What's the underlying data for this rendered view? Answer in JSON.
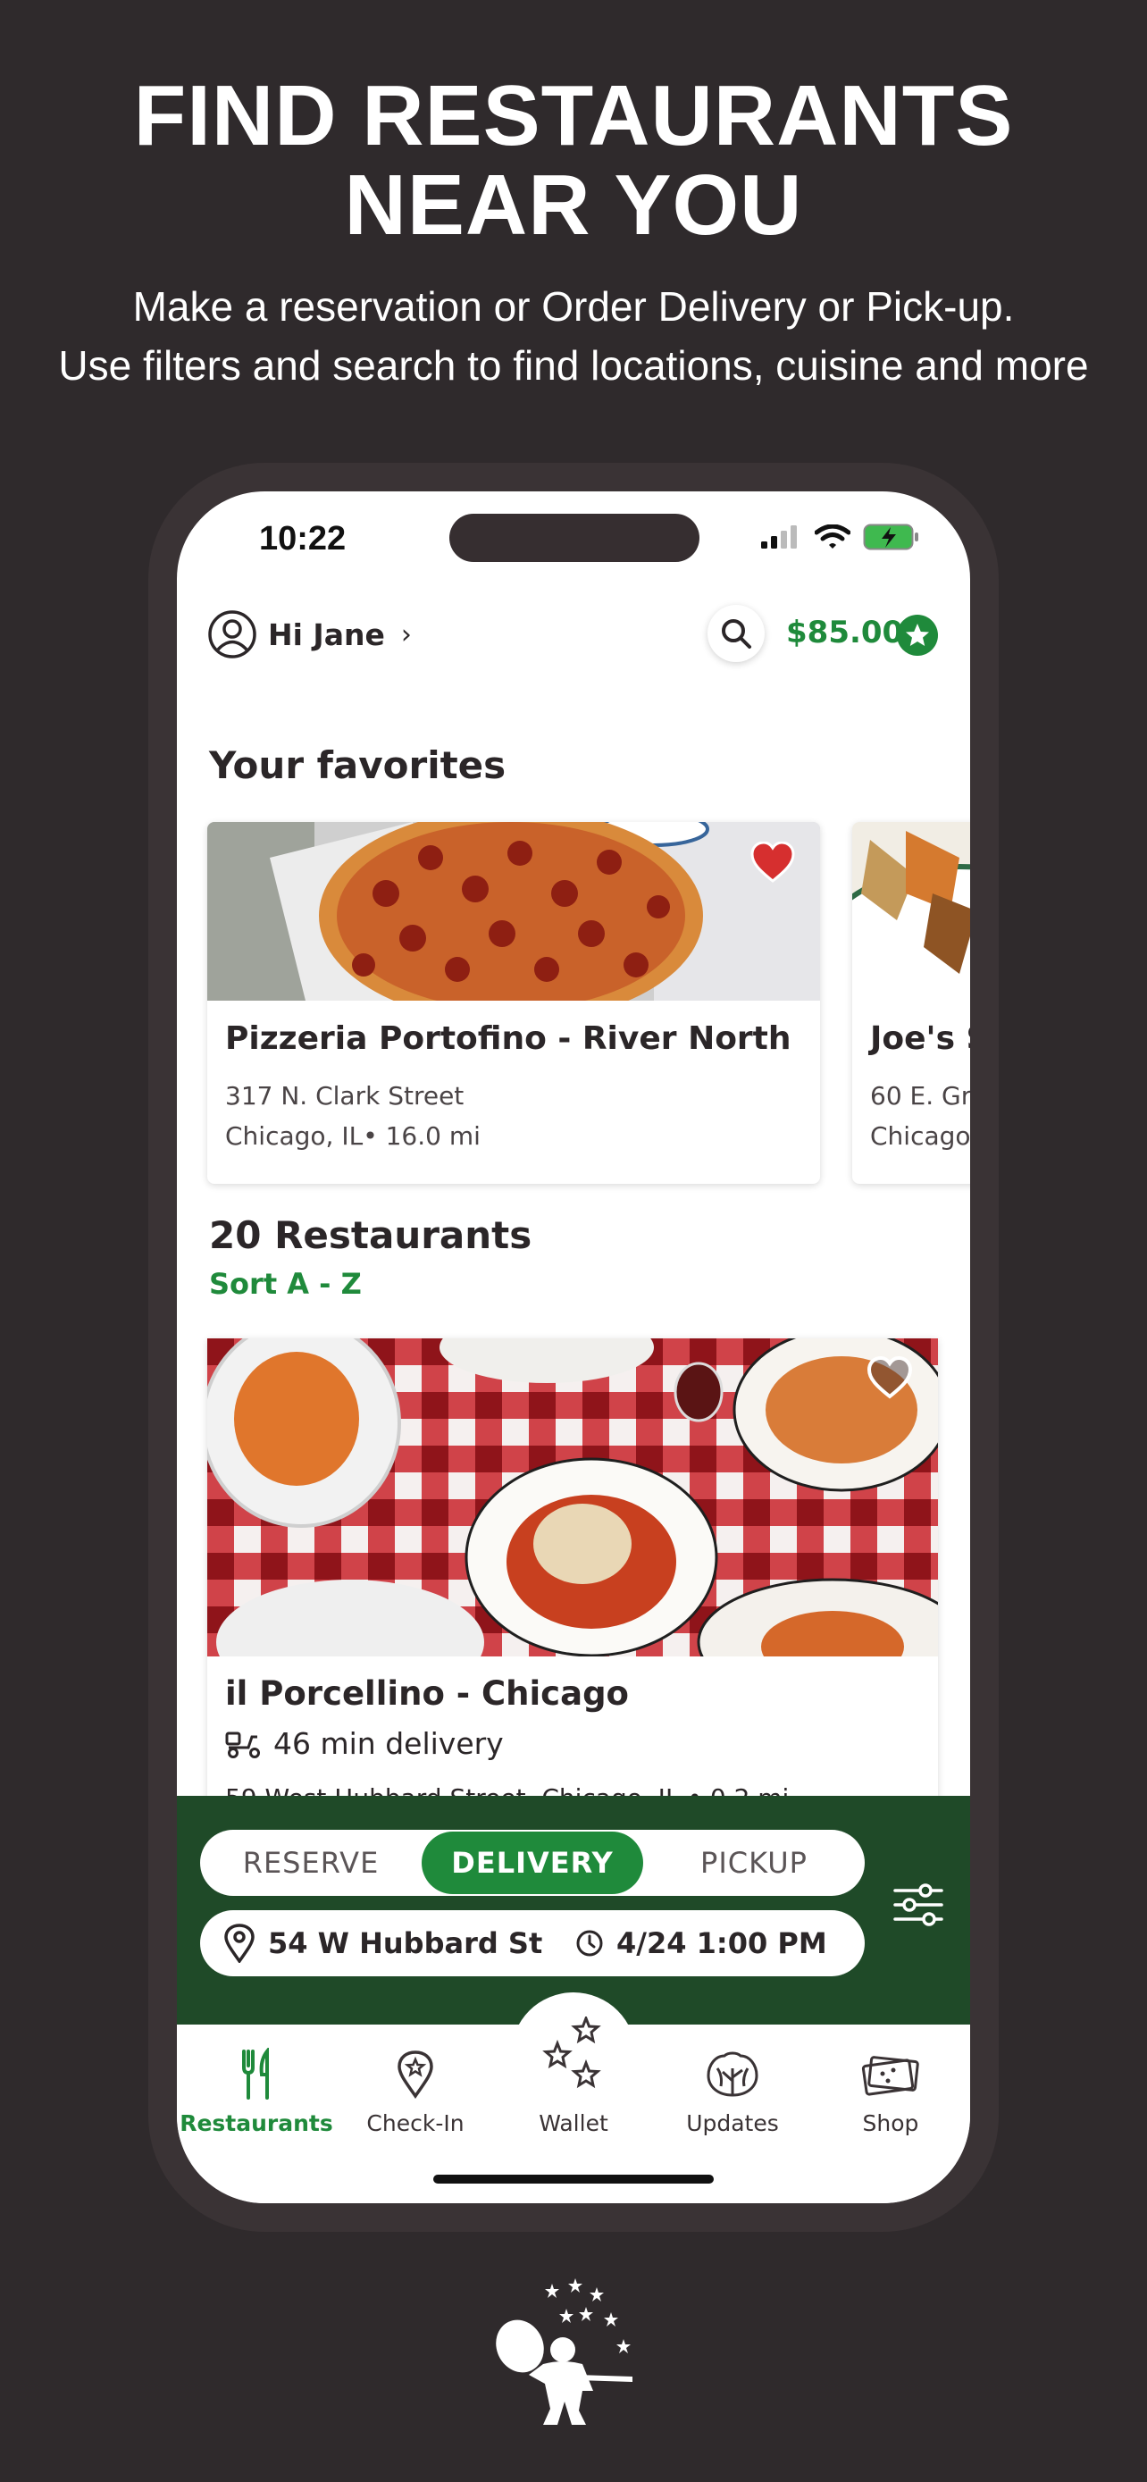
{
  "promo": {
    "title_line1": "FIND RESTAURANTS",
    "title_line2": "NEAR YOU",
    "subtitle_line1": "Make a reservation or Order Delivery or Pick-up.",
    "subtitle_line2": "Use filters and search to find locations, cuisine and more"
  },
  "status_bar": {
    "time": "10:22"
  },
  "header": {
    "greeting": "Hi Jane",
    "balance": "$85.00"
  },
  "favorites": {
    "title": "Your favorites",
    "cards": [
      {
        "name": "Pizzeria Portofino - River North",
        "address": "317 N. Clark Street",
        "city_distance": "Chicago, IL• 16.0 mi",
        "favorited": true
      },
      {
        "name": "Joe's S",
        "address": "60 E. Gra",
        "city_distance": "Chicago,",
        "favorited": true
      }
    ]
  },
  "restaurants": {
    "count_label": "20 Restaurants",
    "sort_label": "Sort A - Z",
    "items": [
      {
        "name": "il Porcellino - Chicago",
        "delivery": "46 min delivery",
        "address": "59 West Hubbard Street, Chicago, IL • 0.2 mi",
        "favorited": false
      }
    ]
  },
  "order_mode": {
    "options": [
      "RESERVE",
      "DELIVERY",
      "PICKUP"
    ],
    "selected": "DELIVERY",
    "address": "54 W Hubbard St",
    "datetime": "4/24 1:00 PM"
  },
  "tabs": [
    {
      "label": "Restaurants",
      "icon": "fork-knife-icon",
      "active": true
    },
    {
      "label": "Check-In",
      "icon": "location-pin-icon",
      "active": false
    },
    {
      "label": "Wallet",
      "icon": "stars-icon",
      "active": false
    },
    {
      "label": "Updates",
      "icon": "lettuce-icon",
      "active": false
    },
    {
      "label": "Shop",
      "icon": "gift-card-icon",
      "active": false
    }
  ],
  "colors": {
    "accent_green": "#1f8a3b",
    "panel_green": "#1f4a28",
    "background": "#2f2a2c",
    "heart_red": "#d62f2f"
  }
}
